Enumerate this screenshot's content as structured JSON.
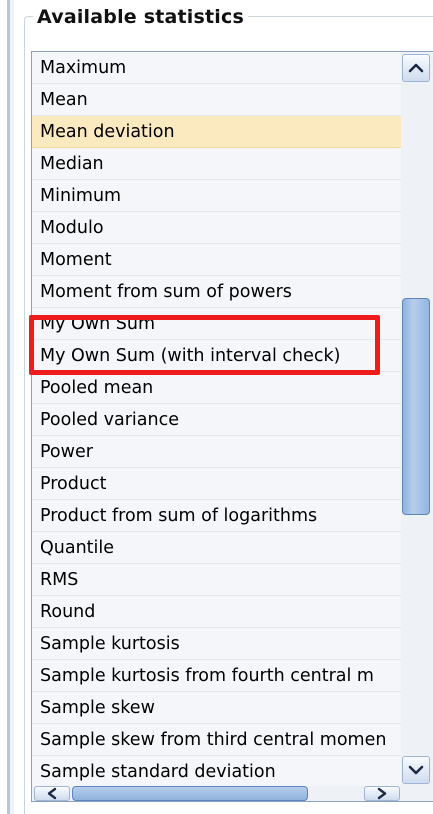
{
  "group": {
    "title": "Available statistics"
  },
  "list": {
    "selected_index": 2,
    "highlighted_indices": [
      8,
      9
    ],
    "items": [
      "Maximum",
      "Mean",
      "Mean deviation",
      "Median",
      "Minimum",
      "Modulo",
      "Moment",
      "Moment from sum of powers",
      "My Own Sum",
      "My Own Sum (with interval check)",
      "Pooled mean",
      "Pooled variance",
      "Power",
      "Product",
      "Product from sum of logarithms",
      "Quantile",
      "RMS",
      "Round",
      "Sample kurtosis",
      "Sample kurtosis from fourth central m",
      "Sample skew",
      "Sample skew from third central momen",
      "Sample standard deviation"
    ]
  },
  "scrollbars": {
    "vertical": {
      "up_icon": "chevron-up-icon",
      "down_icon": "chevron-down-icon"
    },
    "horizontal": {
      "left_icon": "chevron-left-icon",
      "right_icon": "chevron-right-icon"
    }
  },
  "colors": {
    "selected_row": "#fbe9c0",
    "highlight_box": "#ee1c1c",
    "scroll_thumb": "#8fb2de"
  }
}
